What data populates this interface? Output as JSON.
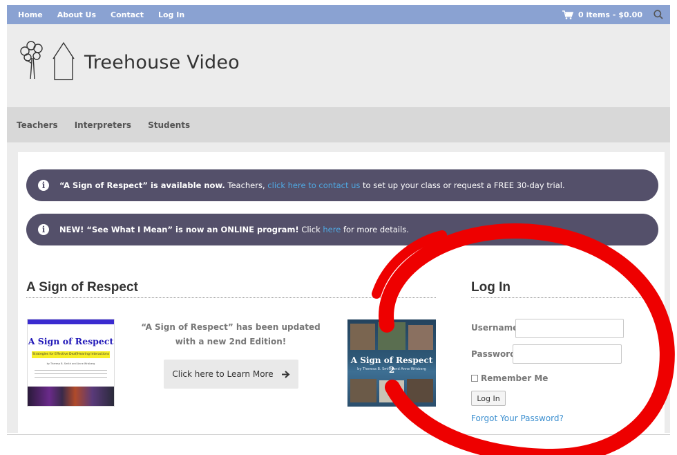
{
  "topbar": {
    "links": [
      "Home",
      "About Us",
      "Contact",
      "Log In"
    ],
    "cart_label": "0 items - $0.00",
    "cart_icon": "shopping-cart-icon",
    "search_icon": "search-icon"
  },
  "header": {
    "site_title": "Treehouse Video",
    "logo_icon": "tree-house-logo-icon"
  },
  "mainnav": {
    "items": [
      "Teachers",
      "Interpreters",
      "Students"
    ]
  },
  "notices": [
    {
      "bold": "“A Sign of Respect” is available now.",
      "pre": " Teachers, ",
      "link": "click here to contact us",
      "post": " to set up your class or request a FREE 30-day trial."
    },
    {
      "bold": "NEW! “See What I Mean” is now an ONLINE program!",
      "pre": " Click ",
      "link": "here",
      "post": " for more details."
    }
  ],
  "respect_section": {
    "title": "A Sign of Respect",
    "book1_title": "A Sign of Respect",
    "book1_subtitle": "Strategies for Effective Deaf/Hearing Interactions",
    "book1_authors": "by Theresa B. Smith and Anne Wrisberg",
    "promo_text": "“A Sign of Respect” has been updated with a new 2nd Edition!",
    "promo_button": "Click here to Learn More",
    "book2_title": "A Sign of Respect 2",
    "book2_authors": "by Theresa B. Smith and Anne Wrisberg"
  },
  "login": {
    "title": "Log In",
    "username_label": "Username",
    "password_label": "Password",
    "remember_label": "Remember Me",
    "button_label": "Log In",
    "forgot_link": "Forgot Your Password?"
  },
  "colors": {
    "topbar": "#8aa2d2",
    "notice_bg": "#54506a",
    "link": "#4fa9e3",
    "annotation_circle": "#ee0000"
  }
}
